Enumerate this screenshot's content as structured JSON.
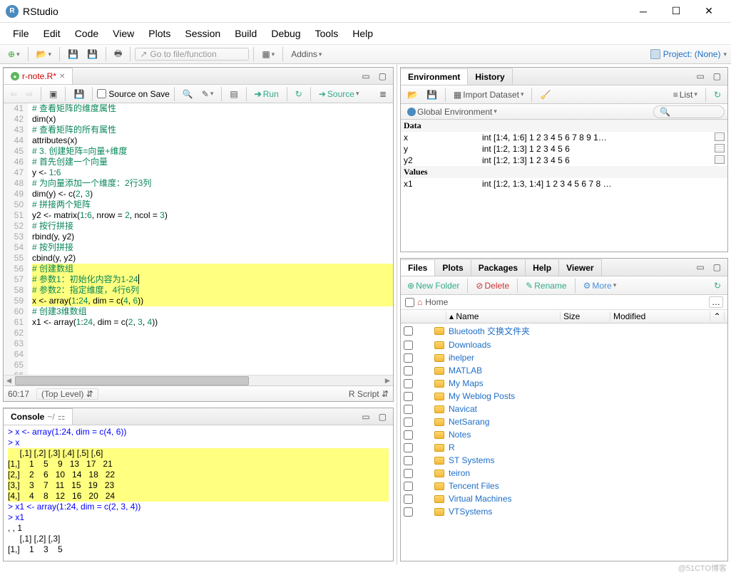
{
  "window": {
    "title": "RStudio"
  },
  "menu": [
    "File",
    "Edit",
    "Code",
    "View",
    "Plots",
    "Session",
    "Build",
    "Debug",
    "Tools",
    "Help"
  ],
  "toolbar": {
    "goto_placeholder": "Go to file/function",
    "addins": "Addins",
    "project_label": "Project: (None)"
  },
  "source": {
    "tab": "r-note.R*",
    "save_on_source": "Source on Save",
    "run": "Run",
    "source_btn": "Source",
    "status_pos": "60:17",
    "status_scope": "(Top Level)",
    "status_lang": "R Script",
    "lines": [
      {
        "n": 41,
        "t": "# 查看矩阵的维度属性",
        "c": "c"
      },
      {
        "n": 42,
        "seg": [
          {
            "t": "dim",
            "c": "i"
          },
          {
            "t": "(x)",
            "c": "i"
          }
        ]
      },
      {
        "n": 43,
        "t": "# 查看矩阵的所有属性",
        "c": "c"
      },
      {
        "n": 44,
        "seg": [
          {
            "t": "attributes",
            "c": "i"
          },
          {
            "t": "(x)",
            "c": "i"
          }
        ]
      },
      {
        "n": 45,
        "t": ""
      },
      {
        "n": 46,
        "t": "# 3. 创建矩阵=向量+维度",
        "c": "c"
      },
      {
        "n": 47,
        "t": "# 首先创建一个向量",
        "c": "c"
      },
      {
        "n": 48,
        "seg": [
          {
            "t": "y ",
            "c": "i"
          },
          {
            "t": "<-",
            "c": "i"
          },
          {
            "t": " 1",
            "c": "n"
          },
          {
            "t": ":",
            "c": "i"
          },
          {
            "t": "6",
            "c": "n"
          }
        ]
      },
      {
        "n": 49,
        "t": "# 为向量添加一个维度：2行3列",
        "c": "c"
      },
      {
        "n": 50,
        "seg": [
          {
            "t": "dim",
            "c": "i"
          },
          {
            "t": "(y) ",
            "c": "i"
          },
          {
            "t": "<-",
            "c": "i"
          },
          {
            "t": " c(",
            "c": "i"
          },
          {
            "t": "2",
            "c": "n"
          },
          {
            "t": ", ",
            "c": "i"
          },
          {
            "t": "3",
            "c": "n"
          },
          {
            "t": ")",
            "c": "i"
          }
        ]
      },
      {
        "n": 51,
        "t": ""
      },
      {
        "n": 52,
        "t": "# 拼接两个矩阵",
        "c": "c"
      },
      {
        "n": 53,
        "seg": [
          {
            "t": "y2 ",
            "c": "i"
          },
          {
            "t": "<-",
            "c": "i"
          },
          {
            "t": " matrix(",
            "c": "i"
          },
          {
            "t": "1",
            "c": "n"
          },
          {
            "t": ":",
            "c": "i"
          },
          {
            "t": "6",
            "c": "n"
          },
          {
            "t": ", nrow = ",
            "c": "i"
          },
          {
            "t": "2",
            "c": "n"
          },
          {
            "t": ", ncol = ",
            "c": "i"
          },
          {
            "t": "3",
            "c": "n"
          },
          {
            "t": ")",
            "c": "i"
          }
        ]
      },
      {
        "n": 54,
        "t": "# 按行拼接",
        "c": "c"
      },
      {
        "n": 55,
        "seg": [
          {
            "t": "rbind",
            "c": "i"
          },
          {
            "t": "(y, y2)",
            "c": "i"
          }
        ]
      },
      {
        "n": 56,
        "t": "# 按列拼接",
        "c": "c"
      },
      {
        "n": 57,
        "seg": [
          {
            "t": "cbind",
            "c": "i"
          },
          {
            "t": "(y, y2)",
            "c": "i"
          }
        ]
      },
      {
        "n": 58,
        "t": ""
      },
      {
        "n": 59,
        "t": "# 创建数组",
        "c": "c",
        "hl": true
      },
      {
        "n": 60,
        "t": "# 参数1：初始化内容为1-24",
        "c": "c",
        "hl": true,
        "cursor": true
      },
      {
        "n": 61,
        "t": "# 参数2：指定维度，4行6列",
        "c": "c",
        "hl": true
      },
      {
        "n": 62,
        "seg": [
          {
            "t": "x ",
            "c": "i"
          },
          {
            "t": "<-",
            "c": "i"
          },
          {
            "t": " array(",
            "c": "i"
          },
          {
            "t": "1",
            "c": "n"
          },
          {
            "t": ":",
            "c": "i"
          },
          {
            "t": "24",
            "c": "n"
          },
          {
            "t": ", dim = c(",
            "c": "i"
          },
          {
            "t": "4",
            "c": "n"
          },
          {
            "t": ", ",
            "c": "i"
          },
          {
            "t": "6",
            "c": "n"
          },
          {
            "t": "))",
            "c": "i"
          }
        ],
        "hl": true
      },
      {
        "n": 63,
        "t": ""
      },
      {
        "n": 64,
        "t": "# 创建3维数组",
        "c": "c"
      },
      {
        "n": 65,
        "seg": [
          {
            "t": "x1 ",
            "c": "i"
          },
          {
            "t": "<-",
            "c": "i"
          },
          {
            "t": " array(",
            "c": "i"
          },
          {
            "t": "1",
            "c": "n"
          },
          {
            "t": ":",
            "c": "i"
          },
          {
            "t": "24",
            "c": "n"
          },
          {
            "t": ", dim = c(",
            "c": "i"
          },
          {
            "t": "2",
            "c": "n"
          },
          {
            "t": ", ",
            "c": "i"
          },
          {
            "t": "3",
            "c": "n"
          },
          {
            "t": ", ",
            "c": "i"
          },
          {
            "t": "4",
            "c": "n"
          },
          {
            "t": "))",
            "c": "i"
          }
        ]
      },
      {
        "n": 66,
        "t": ""
      }
    ]
  },
  "console": {
    "title": "Console",
    "path": "~/",
    "lines": [
      {
        "t": "> x <- array(1:24, dim = c(4, 6))",
        "c": "p"
      },
      {
        "t": "> x",
        "c": "p"
      },
      {
        "t": "     [,1] [,2] [,3] [,4] [,5] [,6]",
        "c": "o",
        "hl": true
      },
      {
        "t": "[1,]    1    5    9   13   17   21",
        "c": "o",
        "hl": true
      },
      {
        "t": "[2,]    2    6   10   14   18   22",
        "c": "o",
        "hl": true
      },
      {
        "t": "[3,]    3    7   11   15   19   23",
        "c": "o",
        "hl": true
      },
      {
        "t": "[4,]    4    8   12   16   20   24",
        "c": "o",
        "hl": true
      },
      {
        "t": "> x1 <- array(1:24, dim = c(2, 3, 4))",
        "c": "p"
      },
      {
        "t": "> x1",
        "c": "p"
      },
      {
        "t": ", , 1",
        "c": "o"
      },
      {
        "t": "",
        "c": "o"
      },
      {
        "t": "     [,1] [,2] [,3]",
        "c": "o"
      },
      {
        "t": "[1,]    1    3    5",
        "c": "o"
      }
    ]
  },
  "env": {
    "tabs": [
      "Environment",
      "History"
    ],
    "import": "Import Dataset",
    "list": "List",
    "scope": "Global Environment",
    "sections": [
      {
        "h": "Data",
        "rows": [
          {
            "n": "x",
            "v": "int [1:4, 1:6] 1 2 3 4 5 6 7 8 9 1…",
            "g": true
          },
          {
            "n": "y",
            "v": "int [1:2, 1:3] 1 2 3 4 5 6",
            "g": true
          },
          {
            "n": "y2",
            "v": "int [1:2, 1:3] 1 2 3 4 5 6",
            "g": true
          }
        ]
      },
      {
        "h": "Values",
        "rows": [
          {
            "n": "x1",
            "v": "int [1:2, 1:3, 1:4] 1 2 3 4 5 6 7 8 …"
          }
        ]
      }
    ]
  },
  "files": {
    "tabs": [
      "Files",
      "Plots",
      "Packages",
      "Help",
      "Viewer"
    ],
    "newfolder": "New Folder",
    "delete": "Delete",
    "rename": "Rename",
    "more": "More",
    "home": "Home",
    "cols": {
      "name": "Name",
      "size": "Size",
      "modified": "Modified"
    },
    "items": [
      "Bluetooth 交换文件夹",
      "Downloads",
      "ihelper",
      "MATLAB",
      "My Maps",
      "My Weblog Posts",
      "Navicat",
      "NetSarang",
      "Notes",
      "R",
      "ST Systems",
      "teiron",
      "Tencent Files",
      "Virtual Machines",
      "VTSystems"
    ]
  },
  "watermark": "@51CTO博客"
}
